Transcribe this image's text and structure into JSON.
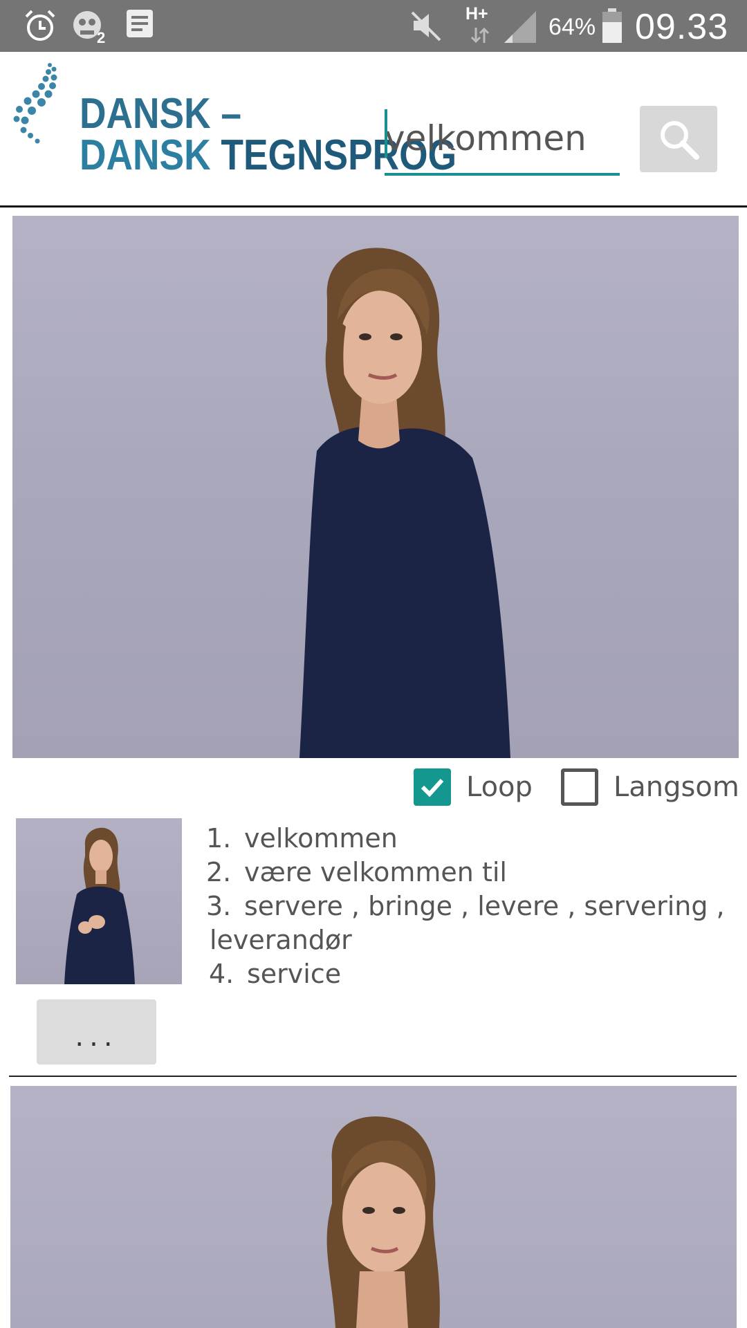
{
  "status_bar": {
    "battery": "64%",
    "time": "09.33",
    "network": "H+"
  },
  "header": {
    "logo_line1": "DANSK –",
    "logo_line2a": "DANSK",
    "logo_line2b": "TEGNSPROG",
    "search": {
      "value": "velkommen",
      "placeholder": ""
    }
  },
  "options": {
    "loop_label": "Loop",
    "loop_checked": true,
    "slow_label": "Langsom",
    "slow_checked": false
  },
  "results": [
    {
      "num": "1.",
      "text": "velkommen"
    },
    {
      "num": "2.",
      "text": "være velkommen til"
    },
    {
      "num": "3.",
      "text": "servere , bringe , levere , servering ,"
    },
    {
      "num": "",
      "text": "leverandør"
    },
    {
      "num": "4.",
      "text": "service"
    }
  ],
  "more_label": "...",
  "colors": {
    "accent": "#14978e",
    "logo_blue": "#2c6f8e",
    "status_bar": "#757575"
  }
}
